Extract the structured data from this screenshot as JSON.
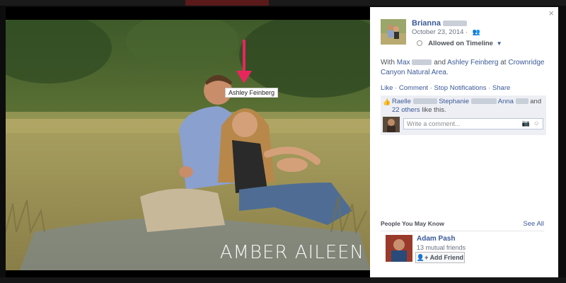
{
  "photo": {
    "watermark": "AMBER AILEEN",
    "tag_label": "Ashley Feinberg"
  },
  "panel": {
    "close_symbol": "×",
    "author_name": "Brianna",
    "date": "October 23, 2014 ·",
    "audience": "Allowed on Timeline",
    "with_prefix": "With",
    "with_person_1": "Max",
    "with_and": "and",
    "with_person_2": "Ashley Feinberg",
    "with_at": "at",
    "with_place": "Crownridge Canyon Natural Area",
    "with_end": ".",
    "actions": [
      "Like",
      "Comment",
      "Stop Notifications",
      "Share"
    ],
    "likes": {
      "name_1": "Raelle",
      "name_2": "Stephanie",
      "name_3": "Anna",
      "and_text": "and",
      "others_link": "22 others",
      "suffix": "like this."
    },
    "comment_placeholder": "Write a comment...",
    "people_you_may_know": {
      "header": "People You May Know",
      "see_all": "See All",
      "person": {
        "name": "Adam Pash",
        "mutual": "13 mutual friends",
        "button": "Add Friend"
      }
    }
  },
  "colors": {
    "link": "#3b5998",
    "tag_arrow": "#e8265e"
  }
}
